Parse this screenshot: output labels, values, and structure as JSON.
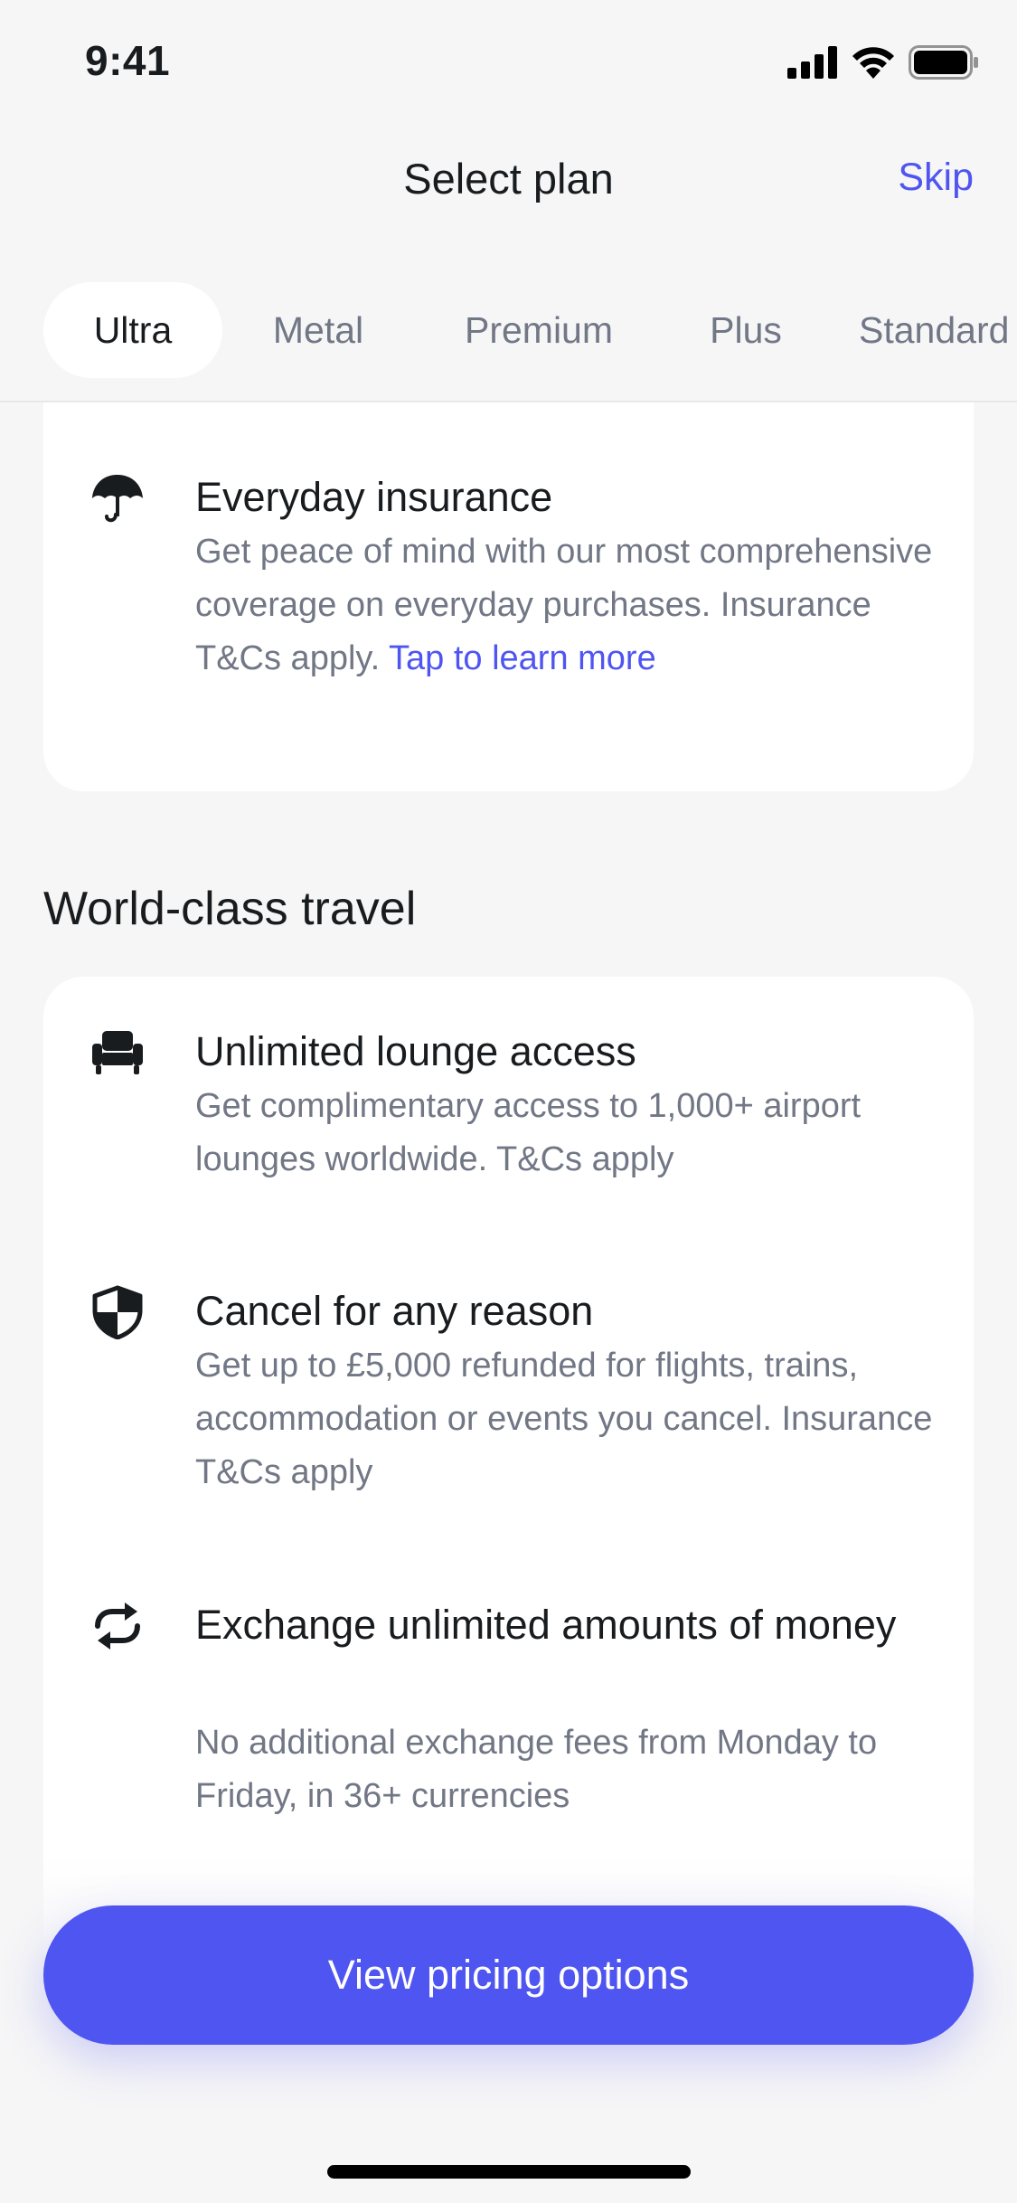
{
  "status_bar": {
    "time": "9:41"
  },
  "header": {
    "title": "Select plan",
    "skip_label": "Skip"
  },
  "tabs": [
    {
      "label": "Ultra",
      "active": true
    },
    {
      "label": "Metal",
      "active": false
    },
    {
      "label": "Premium",
      "active": false
    },
    {
      "label": "Plus",
      "active": false
    },
    {
      "label": "Standard",
      "active": false
    }
  ],
  "top_card": {
    "feature": {
      "icon": "umbrella-icon",
      "title": "Everyday insurance",
      "description": "Get peace of mind with our most comprehensive coverage on everyday purchases. Insurance T&Cs apply. ",
      "link": "Tap to learn more"
    }
  },
  "travel_section": {
    "title": "World-class travel",
    "features": [
      {
        "icon": "lounge-chair-icon",
        "title": "Unlimited lounge access",
        "description": "Get complimentary access to 1,000+ airport lounges worldwide. T&Cs apply"
      },
      {
        "icon": "shield-icon",
        "title": "Cancel for any reason",
        "description": "Get up to £5,000 refunded for flights, trains, accommodation or events you cancel. Insurance T&Cs apply"
      },
      {
        "icon": "exchange-icon",
        "title": "Exchange unlimited amounts of money",
        "description": "No additional exchange fees from Monday to Friday, in 36+ currencies"
      }
    ]
  },
  "cta": {
    "label": "View pricing options"
  },
  "colors": {
    "accent": "#4f55f1",
    "background": "#f6f6f7",
    "muted_text": "#717785"
  }
}
